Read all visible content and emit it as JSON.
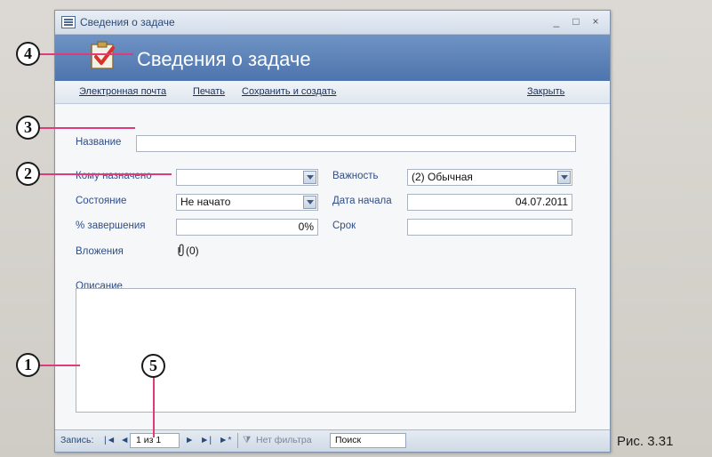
{
  "window": {
    "title": "Сведения о задаче",
    "header_title": "Сведения о задаче",
    "controls": {
      "minimize": "_",
      "maximize": "□",
      "close": "×"
    }
  },
  "toolbar": {
    "email": "Электронная почта",
    "print": "Печать",
    "save_create": "Сохранить и создать",
    "close": "Закрыть"
  },
  "form": {
    "name_label": "Название",
    "name_value": "",
    "assigned_label": "Кому назначено",
    "assigned_value": "",
    "priority_label": "Важность",
    "priority_value": "(2) Обычная",
    "status_label": "Состояние",
    "status_value": "Не начато",
    "start_label": "Дата начала",
    "start_value": "04.07.2011",
    "percent_label": "% завершения",
    "percent_value": "0%",
    "due_label": "Срок",
    "due_value": "",
    "attach_label": "Вложения",
    "attach_value": "(0)",
    "desc_label": "Описание"
  },
  "nav": {
    "record_label": "Запись:",
    "first": "|◄",
    "prev": "◄",
    "position": "1 из 1",
    "next": "►",
    "last": "►|",
    "new": "►*",
    "filter": "Нет фильтра",
    "search": "Поиск"
  },
  "callouts": [
    "1",
    "2",
    "3",
    "4",
    "5"
  ],
  "figure_caption": "Рис. 3.31",
  "colors": {
    "accent": "#e03a7b",
    "header": "#5a7fb7",
    "label": "#2e4d8a"
  }
}
